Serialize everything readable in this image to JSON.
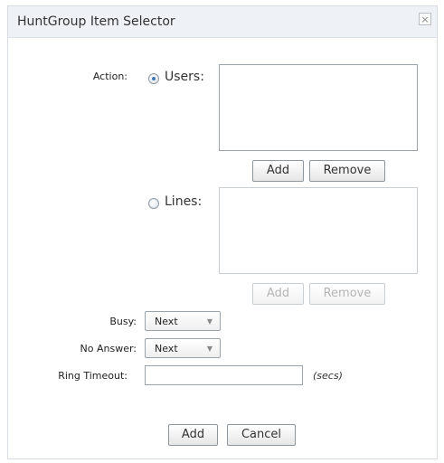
{
  "dialog": {
    "title": "HuntGroup Item Selector",
    "close_glyph": "×"
  },
  "action": {
    "label": "Action:",
    "users": {
      "label": "Users:",
      "selected": true
    },
    "lines": {
      "label": "Lines:",
      "selected": false
    }
  },
  "users_buttons": {
    "add": "Add",
    "remove": "Remove"
  },
  "lines_buttons": {
    "add": "Add",
    "remove": "Remove"
  },
  "busy": {
    "label": "Busy:",
    "value": "Next",
    "arrow": "▼"
  },
  "no_answer": {
    "label": "No Answer:",
    "value": "Next",
    "arrow": "▼"
  },
  "ring_timeout": {
    "label": "Ring Timeout:",
    "value": "",
    "units": "(secs)"
  },
  "footer": {
    "add": "Add",
    "cancel": "Cancel"
  },
  "icons": {
    "close": "close-icon",
    "dropdown": "chevron-down-icon"
  }
}
